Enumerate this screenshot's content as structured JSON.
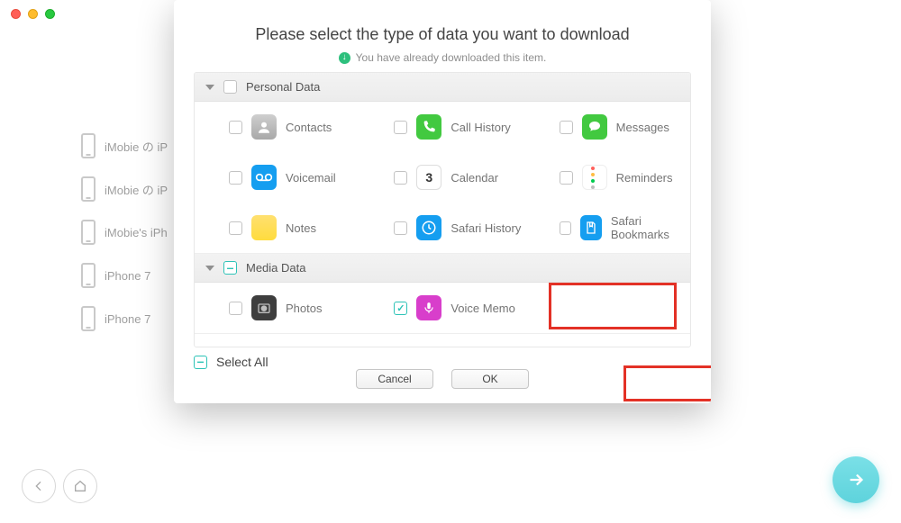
{
  "sidebar": {
    "items": [
      {
        "label": "iMobie の iP"
      },
      {
        "label": "iMobie の iP"
      },
      {
        "label": "iMobie's iPh"
      },
      {
        "label": "iPhone 7"
      },
      {
        "label": "iPhone 7"
      }
    ]
  },
  "modal": {
    "title": "Please select the type of data you want to download",
    "subtitle": "You have already downloaded this item.",
    "select_all_label": "Select All",
    "cancel_label": "Cancel",
    "ok_label": "OK"
  },
  "categories": [
    {
      "title": "Personal Data",
      "items": [
        {
          "label": "Contacts",
          "icon": "contacts-icon",
          "checked": false
        },
        {
          "label": "Call History",
          "icon": "call-history-icon",
          "checked": false
        },
        {
          "label": "Messages",
          "icon": "messages-icon",
          "checked": false
        },
        {
          "label": "Voicemail",
          "icon": "voicemail-icon",
          "checked": false
        },
        {
          "label": "Calendar",
          "icon": "calendar-icon",
          "checked": false,
          "glyph": "3"
        },
        {
          "label": "Reminders",
          "icon": "reminders-icon",
          "checked": false
        },
        {
          "label": "Notes",
          "icon": "notes-icon",
          "checked": false
        },
        {
          "label": "Safari History",
          "icon": "safari-history-icon",
          "checked": false
        },
        {
          "label": "Safari Bookmarks",
          "icon": "safari-bookmarks-icon",
          "checked": false
        }
      ]
    },
    {
      "title": "Media Data",
      "items": [
        {
          "label": "Photos",
          "icon": "photos-icon",
          "checked": false
        },
        {
          "label": "Voice Memo",
          "icon": "voice-memo-icon",
          "checked": true
        }
      ]
    }
  ],
  "colors": {
    "highlight": "#e33126",
    "accent": "#2dc3b7"
  }
}
